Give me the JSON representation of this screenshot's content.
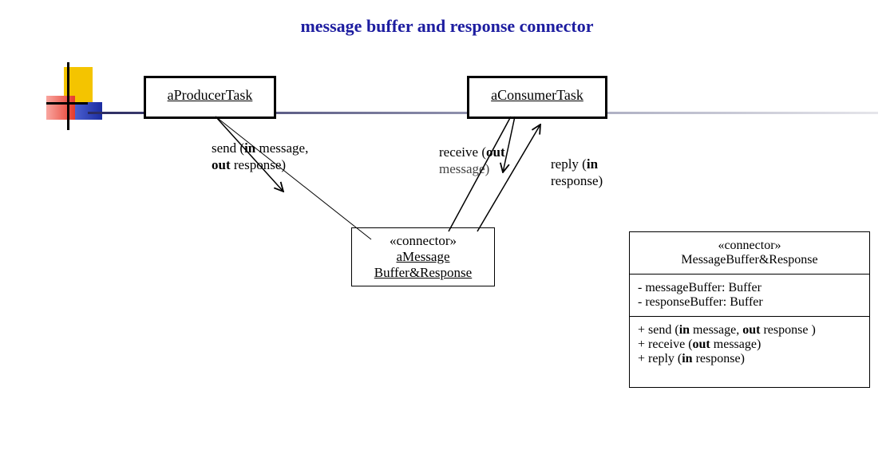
{
  "title": "message buffer and response connector",
  "producer": "aProducerTask",
  "consumer": "aConsumerTask",
  "connector": {
    "stereo": "«connector»",
    "name1": "aMessage",
    "name2": "Buffer&Response"
  },
  "labels": {
    "send_pre": "send (",
    "send_in": "in",
    "send_mid": " message,",
    "send_out": "out",
    "send_post": " response)",
    "recv_pre": "receive (",
    "recv_out": "out",
    "recv_post": "message)",
    "reply_pre": "reply (",
    "reply_in": "in",
    "reply_post": "response)"
  },
  "uml": {
    "stereo": "«connector»",
    "name": "MessageBuffer&Response",
    "attr1": "- messageBuffer: Buffer",
    "attr2": "- responseBuffer: Buffer",
    "op1a": "+ send (",
    "op1b": "in",
    "op1c": " message, ",
    "op1d": "out",
    "op1e": " response )",
    "op2a": "+ receive  (",
    "op2b": "out",
    "op2c": " message)",
    "op3a": "+ reply (",
    "op3b": "in",
    "op3c": " response)"
  }
}
